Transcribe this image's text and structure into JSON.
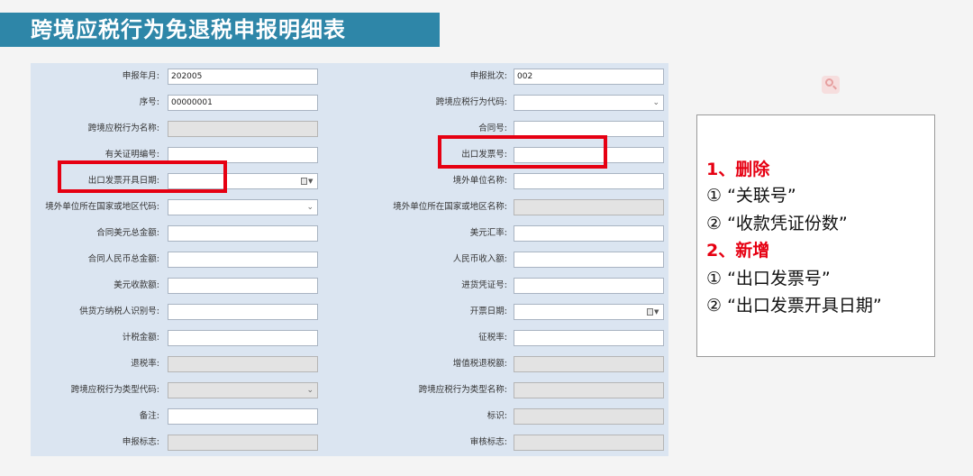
{
  "header": {
    "title": "跨境应税行为免退税申报明细表"
  },
  "form": {
    "left": [
      {
        "label": "申报年月:",
        "value": "202005",
        "kind": "input"
      },
      {
        "label": "序号:",
        "value": "00000001",
        "kind": "input"
      },
      {
        "label": "跨境应税行为名称:",
        "value": "",
        "kind": "readonly"
      },
      {
        "label": "有关证明编号:",
        "value": "",
        "kind": "input"
      },
      {
        "label": "出口发票开具日期:",
        "value": "",
        "kind": "date"
      },
      {
        "label": "境外单位所在国家或地区代码:",
        "value": "",
        "kind": "select"
      },
      {
        "label": "合同美元总金额:",
        "value": "",
        "kind": "input"
      },
      {
        "label": "合同人民币总金额:",
        "value": "",
        "kind": "input"
      },
      {
        "label": "美元收款额:",
        "value": "",
        "kind": "input"
      },
      {
        "label": "供货方纳税人识别号:",
        "value": "",
        "kind": "input"
      },
      {
        "label": "计税金额:",
        "value": "",
        "kind": "input"
      },
      {
        "label": "退税率:",
        "value": "",
        "kind": "readonly"
      },
      {
        "label": "跨境应税行为类型代码:",
        "value": "",
        "kind": "select-ro"
      },
      {
        "label": "备注:",
        "value": "",
        "kind": "input"
      },
      {
        "label": "申报标志:",
        "value": "",
        "kind": "readonly"
      }
    ],
    "right": [
      {
        "label": "申报批次:",
        "value": "002",
        "kind": "input"
      },
      {
        "label": "跨境应税行为代码:",
        "value": "",
        "kind": "select"
      },
      {
        "label": "合同号:",
        "value": "",
        "kind": "input"
      },
      {
        "label": "出口发票号:",
        "value": "",
        "kind": "input"
      },
      {
        "label": "境外单位名称:",
        "value": "",
        "kind": "input"
      },
      {
        "label": "境外单位所在国家或地区名称:",
        "value": "",
        "kind": "readonly"
      },
      {
        "label": "美元汇率:",
        "value": "",
        "kind": "input"
      },
      {
        "label": "人民币收入额:",
        "value": "",
        "kind": "input"
      },
      {
        "label": "进货凭证号:",
        "value": "",
        "kind": "input"
      },
      {
        "label": "开票日期:",
        "value": "",
        "kind": "date"
      },
      {
        "label": "征税率:",
        "value": "",
        "kind": "input"
      },
      {
        "label": "增值税退税额:",
        "value": "",
        "kind": "readonly"
      },
      {
        "label": "跨境应税行为类型名称:",
        "value": "",
        "kind": "readonly"
      },
      {
        "label": "标识:",
        "value": "",
        "kind": "readonly"
      },
      {
        "label": "审核标志:",
        "value": "",
        "kind": "readonly"
      }
    ]
  },
  "notes": [
    {
      "text": "1、删除",
      "style": "red"
    },
    {
      "text": "① “关联号”",
      "style": "black"
    },
    {
      "text": "② “收款凭证份数”",
      "style": "black"
    },
    {
      "text": "2、新增",
      "style": "red"
    },
    {
      "text": "① “出口发票号”",
      "style": "black"
    },
    {
      "text": "② “出口发票开具日期”",
      "style": "black"
    }
  ],
  "colors": {
    "title_bar": "#2e86a8",
    "form_bg": "#dbe5f1",
    "highlight": "#e60012",
    "note_red": "#e60012"
  },
  "icons": {
    "select": "chevron-down-icon",
    "date": "calendar-icon",
    "decor": "search-icon"
  }
}
